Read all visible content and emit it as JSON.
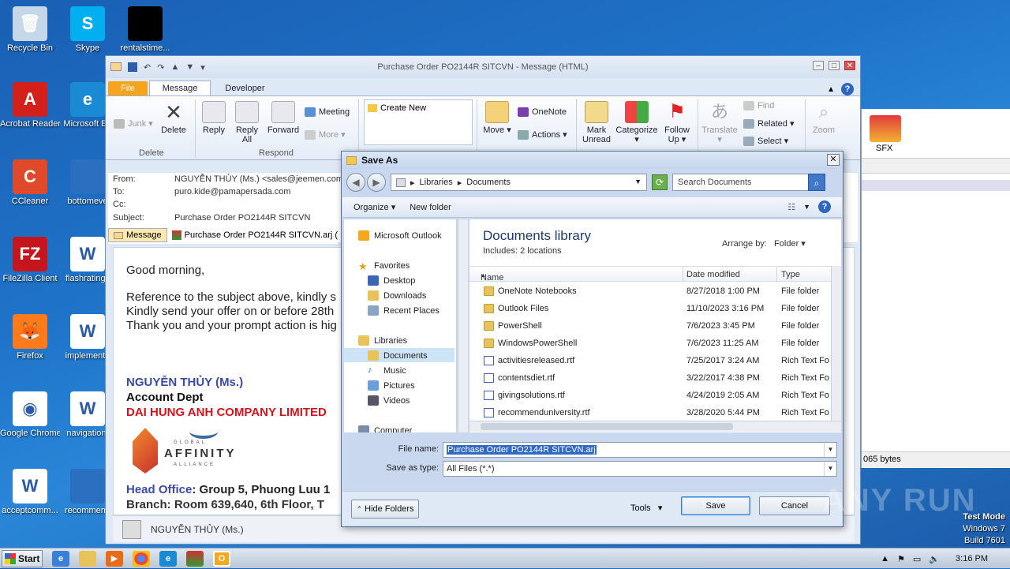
{
  "desktop": {
    "icons": [
      {
        "label": "Recycle Bin",
        "glyph": "🗑",
        "color": "#c7d7ea"
      },
      {
        "label": "Skype",
        "glyph": "S",
        "color": "#00aff0"
      },
      {
        "label": "rentalstime...",
        "glyph": "",
        "color": "#000000"
      },
      {
        "label": "Acrobat Reader DC",
        "glyph": "A",
        "color": "#d4201b"
      },
      {
        "label": "Microsoft Ed",
        "glyph": "e",
        "color": "#1a8ad4"
      },
      {
        "label": "CCleaner",
        "glyph": "C",
        "color": "#e04a2a"
      },
      {
        "label": "bottomeve",
        "glyph": "",
        "color": "#2a6fc0"
      },
      {
        "label": "FileZilla Client",
        "glyph": "FZ",
        "color": "#c4161c"
      },
      {
        "label": "flashratings",
        "glyph": "W",
        "color": "#ffffff"
      },
      {
        "label": "Firefox",
        "glyph": "🦊",
        "color": "#ff7a1a"
      },
      {
        "label": "implementa",
        "glyph": "W",
        "color": "#ffffff"
      },
      {
        "label": "Google Chrome",
        "glyph": "◉",
        "color": "#ffffff"
      },
      {
        "label": "navigationf",
        "glyph": "W",
        "color": "#ffffff"
      },
      {
        "label": "acceptcomm...",
        "glyph": "W",
        "color": "#ffffff"
      },
      {
        "label": "recommend",
        "glyph": "",
        "color": "#2a6fc0"
      }
    ],
    "sfx_label": "SFX"
  },
  "outlook": {
    "title": "Purchase Order PO2144R SITCVN  -  Message (HTML)",
    "tabs": {
      "file": "File",
      "message": "Message",
      "developer": "Developer"
    },
    "ribbon": {
      "junk": "Junk ▾",
      "delete": "Delete",
      "group_delete": "Delete",
      "reply": "Reply",
      "reply_all": "Reply All",
      "forward": "Forward",
      "meeting": "Meeting",
      "more": "More ▾",
      "group_respond": "Respond",
      "create_new": "Create New",
      "move": "Move ▾",
      "onenote": "OneNote",
      "actions": "Actions ▾",
      "mark_unread": "Mark Unread",
      "categorize": "Categorize ▾",
      "follow_up": "Follow Up ▾",
      "translate": "Translate ▾",
      "find": "Find",
      "related": "Related ▾",
      "select": "Select ▾",
      "zoom": "Zoom"
    },
    "header": {
      "from_label": "From:",
      "from_value": "NGUYỄN THỦY (Ms.) <sales@jeemen.com>",
      "to_label": "To:",
      "to_value": "puro.kide@pamapersada.com",
      "cc_label": "Cc:",
      "subject_label": "Subject:",
      "subject_value": "Purchase Order PO2144R SITCVN",
      "message_tab": "Message",
      "attachment": "Purchase Order PO2144R SITCVN.arj ("
    },
    "body": {
      "greeting": "Good morning,",
      "line1": "Reference to the subject above, kindly s",
      "line2": "Kindly send your offer on or before 28th",
      "line3": "Thank you and your prompt action is hig",
      "sig_name": "NGUYỄN THỦY (Ms.)",
      "sig_dept": "Account Dept",
      "sig_company": "DAI HUNG ANH COMPANY LIMITED",
      "logo_top": "GLOBAL",
      "logo_main": "AFFINITY",
      "logo_bottom": "ALLIANCE",
      "head_office_label": "Head Office",
      "head_office_value": ": Group 5, Phuong Luu 1",
      "branch": "Branch: Room 639,640, 6th Floor, T"
    },
    "sender_bar": "NGUYỄN THỦY (Ms.)"
  },
  "right_window": {
    "bytes": "065 bytes",
    "sfx": "SFX"
  },
  "save_as": {
    "title": "Save As",
    "address": {
      "root": "Libraries",
      "folder": "Documents"
    },
    "search_placeholder": "Search Documents",
    "toolbar": {
      "organize": "Organize ▾",
      "new_folder": "New folder"
    },
    "left_nav": {
      "outlook": "Microsoft Outlook",
      "favorites": "Favorites",
      "desktop": "Desktop",
      "downloads": "Downloads",
      "recent": "Recent Places",
      "libraries": "Libraries",
      "documents": "Documents",
      "music": "Music",
      "pictures": "Pictures",
      "videos": "Videos",
      "computer": "Computer"
    },
    "library_title": "Documents library",
    "library_sub": "Includes:  2 locations",
    "arrange_label": "Arrange by:",
    "arrange_value": "Folder  ▾",
    "columns": {
      "name": "Name",
      "date": "Date modified",
      "type": "Type"
    },
    "files": [
      {
        "name": "OneNote Notebooks",
        "date": "8/27/2018 1:00 PM",
        "type": "File folder",
        "kind": "folder"
      },
      {
        "name": "Outlook Files",
        "date": "11/10/2023 3:16 PM",
        "type": "File folder",
        "kind": "folder"
      },
      {
        "name": "PowerShell",
        "date": "7/6/2023 3:45 PM",
        "type": "File folder",
        "kind": "folder"
      },
      {
        "name": "WindowsPowerShell",
        "date": "7/6/2023 11:25 AM",
        "type": "File folder",
        "kind": "folder"
      },
      {
        "name": "activitiesreleased.rtf",
        "date": "7/25/2017 3:24 AM",
        "type": "Rich Text Fo",
        "kind": "doc"
      },
      {
        "name": "contentsdiet.rtf",
        "date": "3/22/2017 4:38 PM",
        "type": "Rich Text Fo",
        "kind": "doc"
      },
      {
        "name": "givingsolutions.rtf",
        "date": "4/24/2019 2:05 AM",
        "type": "Rich Text Fo",
        "kind": "doc"
      },
      {
        "name": "recommenduniversity.rtf",
        "date": "3/28/2020 5:44 PM",
        "type": "Rich Text Fo",
        "kind": "doc"
      }
    ],
    "file_name_label": "File name:",
    "file_name_value": "Purchase Order PO2144R SITCVN.arj",
    "save_type_label": "Save as type:",
    "save_type_value": "All Files (*.*)",
    "hide_folders": "Hide Folders",
    "tools": "Tools",
    "save": "Save",
    "cancel": "Cancel"
  },
  "taskbar": {
    "start": "Start",
    "clock": "3:16 PM"
  },
  "watermark": "ANY RUN",
  "test_mode": {
    "line1": "Test Mode",
    "line2": "Windows 7",
    "line3": "Build 7601"
  }
}
